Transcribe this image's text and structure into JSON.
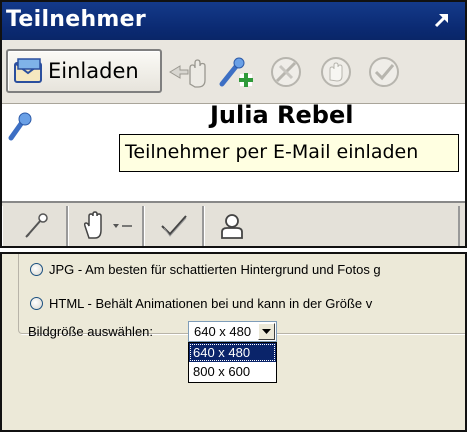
{
  "participants_panel": {
    "title": "Teilnehmer",
    "invite_button_label": "Einladen",
    "partial_name": "Julia Rebel",
    "tooltip": "Teilnehmer per E-Mail einladen"
  },
  "export_options": {
    "radio_jpg": "JPG - Am besten für schattierten Hintergrund und Fotos g",
    "radio_html": "HTML - Behält Animationen bei und kann in der Größe v",
    "image_size_label": "Bildgröße auswählen:",
    "image_size_selected": "640 x 480",
    "image_size_options": [
      "640 x 480",
      "800 x 600"
    ]
  }
}
